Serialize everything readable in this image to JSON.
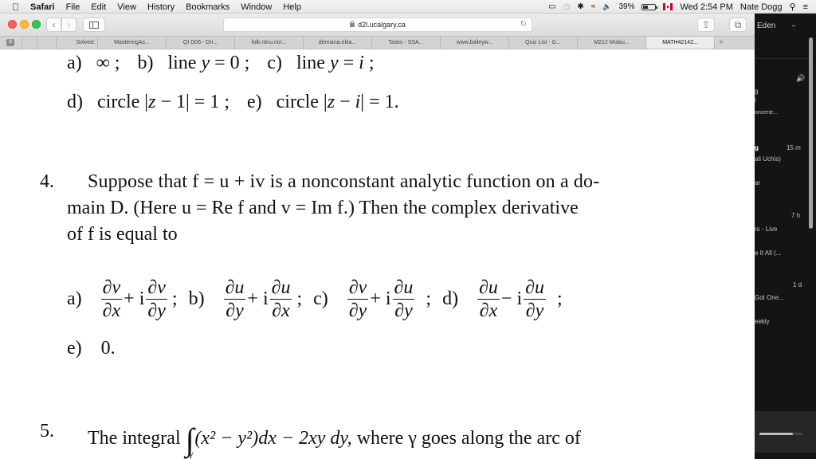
{
  "menubar": {
    "app": "Safari",
    "items": [
      "File",
      "Edit",
      "View",
      "History",
      "Bookmarks",
      "Window",
      "Help"
    ],
    "battery": "39%",
    "clock": "Wed 2:54 PM",
    "user": "Nate Dogg"
  },
  "browser": {
    "url": "d2l.ucalgary.ca",
    "pinned_badge": "8",
    "tabs": [
      {
        "label": "Solved:"
      },
      {
        "label": "MasteringAs..."
      },
      {
        "label": "QI D06 - Dri..."
      },
      {
        "label": "folk.ntnu.no/..."
      },
      {
        "label": "demiana.ekla..."
      },
      {
        "label": "Tasks - SSA..."
      },
      {
        "label": "www.baileyw..."
      },
      {
        "label": "Quiz List - G..."
      },
      {
        "label": "M212 Mobiu..."
      },
      {
        "label": "MATH42142...",
        "active": true
      }
    ],
    "new_tab": "+"
  },
  "document": {
    "q3_line1": {
      "a_label": "a)",
      "a_text": "∞ ;",
      "b_label": "b)",
      "b_text": "line",
      "b_math": "y",
      "b_rest": "= 0 ;",
      "c_label": "c)",
      "c_text": "line",
      "c_math": "y",
      "c_rest": "=",
      "c_i": "i",
      "c_end": ";"
    },
    "q3_line2": {
      "d_label": "d)",
      "d_text": "circle |",
      "d_z": "z",
      "d_rest": "− 1| = 1 ;",
      "e_label": "e)",
      "e_text": "circle |",
      "e_z": "z",
      "e_minus": "−",
      "e_i": "i",
      "e_rest": "| = 1."
    },
    "q4": {
      "number": "4.",
      "line1": "Suppose that f = u + iv is a nonconstant analytic function on a do-",
      "line2": "main D. (Here u = Re f and v = Im f.) Then the complex derivative",
      "line3": "of f is equal to",
      "options": [
        {
          "label": "a)",
          "num1": "∂v",
          "den1": "∂x",
          "op": "+ i",
          "num2": "∂v",
          "den2": "∂y",
          "end": ";"
        },
        {
          "label": "b)",
          "num1": "∂u",
          "den1": "∂y",
          "op": "+ i",
          "num2": "∂u",
          "den2": "∂x",
          "end": ";"
        },
        {
          "label": "c)",
          "num1": "∂v",
          "den1": "∂y",
          "op": "+ i",
          "num2": "∂u",
          "den2": "∂y",
          "end": ";"
        },
        {
          "label": "d)",
          "num1": "∂u",
          "den1": "∂x",
          "op": "− i",
          "num2": "∂u",
          "den2": "∂y",
          "end": ";"
        }
      ],
      "option_e_label": "e)",
      "option_e_value": "0."
    },
    "q5": {
      "number": "5.",
      "lead": "The integral",
      "integral": "∫",
      "subscript": "γ",
      "expr": "(x² − y²)dx − 2xy dy,",
      "rest": "where γ goes along the arc of"
    }
  },
  "right_panel": {
    "header": "Eden",
    "items": [
      {
        "line1": "g",
        "line2": "i",
        "line3": "oncentr..."
      },
      {
        "title": "g",
        "subtitle": "ali Uchis)",
        "time": "15 m"
      },
      {
        "title": "ar"
      },
      {
        "time": "7 h"
      },
      {
        "title": "rs - Live"
      },
      {
        "title": "e It All (..."
      },
      {
        "time": "1 d"
      },
      {
        "title": "Got One..."
      },
      {
        "title": "eekly"
      }
    ],
    "playback_progress": 0.78
  }
}
